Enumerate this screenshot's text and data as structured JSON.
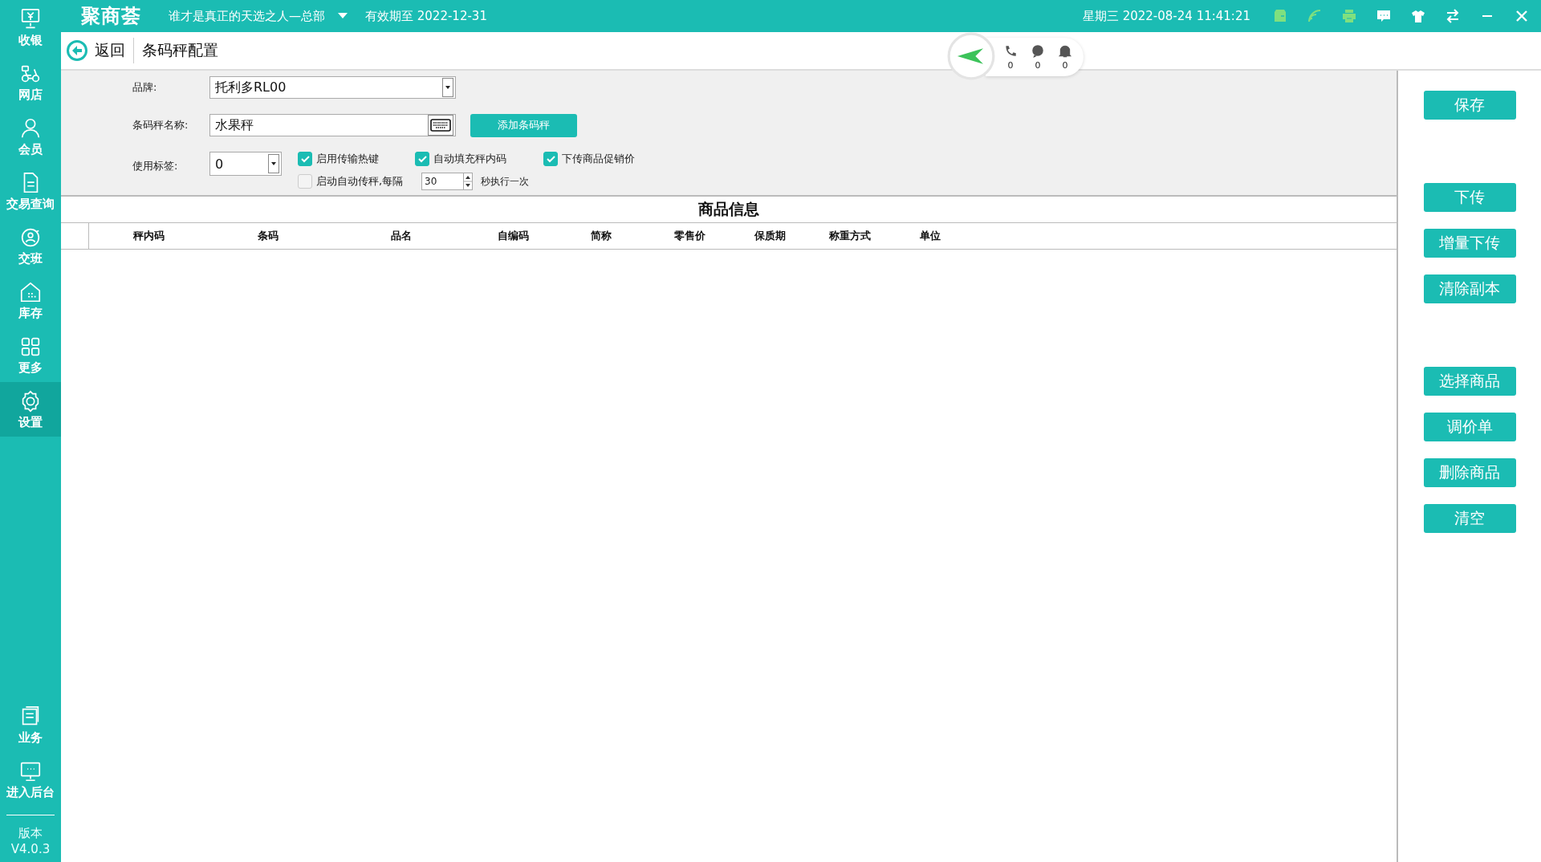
{
  "sidebar": {
    "items": [
      {
        "label": "收银",
        "selected": false
      },
      {
        "label": "网店",
        "selected": false
      },
      {
        "label": "会员",
        "selected": false
      },
      {
        "label": "交易查询",
        "selected": false
      },
      {
        "label": "交班",
        "selected": false
      },
      {
        "label": "库存",
        "selected": false
      },
      {
        "label": "更多",
        "selected": false
      },
      {
        "label": "设置",
        "selected": true
      }
    ],
    "bottom_items": [
      {
        "label": "业务"
      },
      {
        "label": "进入后台"
      }
    ],
    "version_label": "版本",
    "version": "V4.0.3"
  },
  "top_bar": {
    "logo": "聚商荟",
    "store": "谁才是真正的天选之人—总部",
    "validity": "有效期至 2022-12-31",
    "datetime": "星期三 2022-08-24 11:41:21"
  },
  "header": {
    "back": "返回",
    "title": "条码秤配置",
    "counters": [
      "0",
      "0",
      "0"
    ]
  },
  "form": {
    "brand_label": "品牌:",
    "brand": "托利多RL00",
    "name_label": "条码秤名称:",
    "name": "水果秤",
    "add_button": "添加条码秤",
    "tag_label": "使用标签:",
    "tag": "0",
    "checkboxes": [
      {
        "label": "启用传输热键",
        "checked": true
      },
      {
        "label": "自动填充秤内码",
        "checked": true
      },
      {
        "label": "下传商品促销价",
        "checked": true
      },
      {
        "label": "启动自动传秤,每隔",
        "checked": false
      }
    ],
    "interval": "30",
    "interval_suffix": "秒执行一次"
  },
  "table": {
    "title": "商品信息",
    "columns": [
      "秤内码",
      "条码",
      "品名",
      "自编码",
      "简称",
      "零售价",
      "保质期",
      "称重方式",
      "单位"
    ]
  },
  "button_groups": [
    [
      "保存"
    ],
    [
      "下传",
      "增量下传",
      "清除副本"
    ],
    [
      "选择商品",
      "调价单",
      "删除商品",
      "清空"
    ]
  ]
}
